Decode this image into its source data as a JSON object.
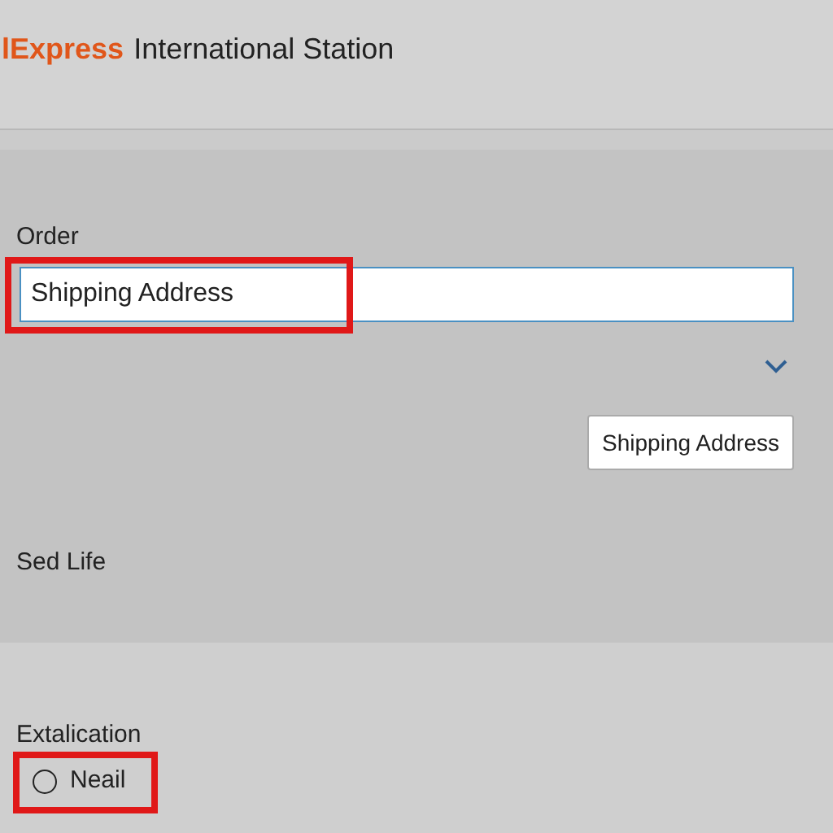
{
  "header": {
    "brand": "lExpress",
    "title": "International Station"
  },
  "order": {
    "label": "Order",
    "field": {
      "value": "Shipping Address",
      "highlighted": true
    },
    "expanded": false,
    "button": "Shipping Address",
    "note": "Sed Life"
  },
  "options": {
    "label": "Extalication",
    "radios": [
      {
        "label": "Neail",
        "selected": false,
        "highlighted": true
      }
    ]
  }
}
